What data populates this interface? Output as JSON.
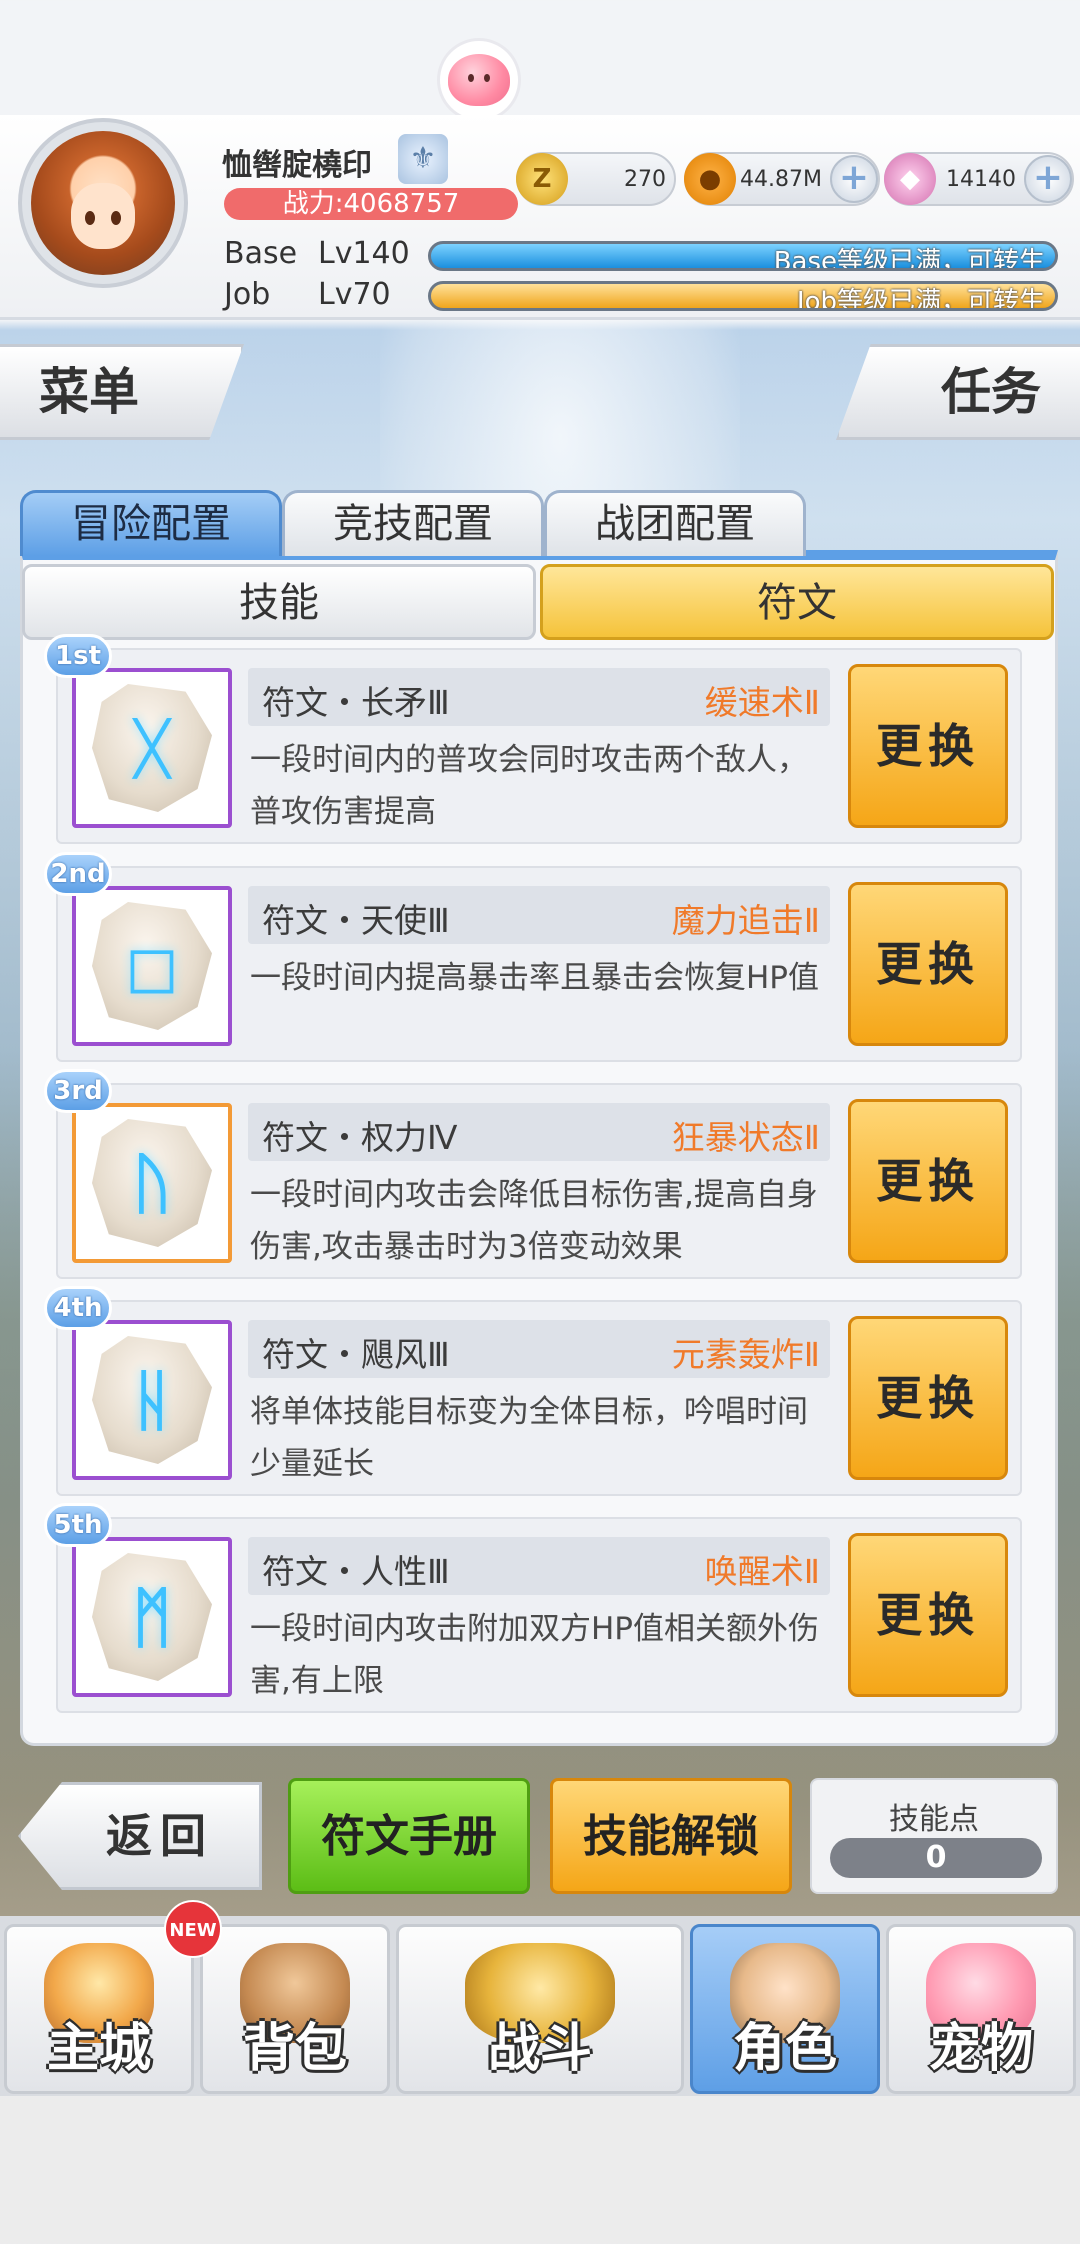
{
  "header": {
    "player_name": "恤辔腚橈印",
    "combat_power": "战力:4068757",
    "currencies": [
      {
        "name": "zeny",
        "icon": "zeny-coin-icon",
        "value": "270"
      },
      {
        "name": "gold",
        "icon": "gold-coin-icon",
        "value": "44.87M"
      },
      {
        "name": "gem",
        "icon": "diamond-icon",
        "value": "14140"
      }
    ],
    "base": {
      "label": "Base",
      "level": "Lv140",
      "status": "Base等级已满，可转生"
    },
    "job": {
      "label": "Job",
      "level": "Lv70",
      "status": "Job等级已满，可转生"
    }
  },
  "side_tabs": {
    "menu": "菜单",
    "quest": "任务"
  },
  "config_tabs": [
    {
      "label": "冒险配置",
      "active": true
    },
    {
      "label": "竞技配置",
      "active": false
    },
    {
      "label": "战团配置",
      "active": false
    }
  ],
  "sub_tabs": [
    {
      "label": "技能",
      "active": false
    },
    {
      "label": "符文",
      "active": true
    }
  ],
  "runes": [
    {
      "rank": "1st",
      "name": "符文・长矛Ⅲ",
      "skill": "缓速术Ⅱ",
      "desc": "一段时间内的普攻会同时攻击两个敌人，普攻伤害提高",
      "glyph": "ᚷ",
      "frame": "purple"
    },
    {
      "rank": "2nd",
      "name": "符文・天使Ⅲ",
      "skill": "魔力追击Ⅱ",
      "desc": "一段时间内提高暴击率且暴击会恢复HP值",
      "glyph": "◻",
      "frame": "purple"
    },
    {
      "rank": "3rd",
      "name": "符文・权力Ⅳ",
      "skill": "狂暴状态Ⅱ",
      "desc": "一段时间内攻击会降低目标伤害,提高自身伤害,攻击暴击时为3倍变动效果",
      "glyph": "ᚢ",
      "frame": "orange"
    },
    {
      "rank": "4th",
      "name": "符文・飓风Ⅲ",
      "skill": "元素轰炸Ⅱ",
      "desc": "将单体技能目标变为全体目标，吟唱时间少量延长",
      "glyph": "ᚺ",
      "frame": "purple"
    },
    {
      "rank": "5th",
      "name": "符文・人性Ⅲ",
      "skill": "唤醒术Ⅱ",
      "desc": "一段时间内攻击附加双方HP值相关额外伤害,有上限",
      "glyph": "ᛗ",
      "frame": "purple"
    }
  ],
  "swap_label": "更换",
  "actions": {
    "back": "返回",
    "rune_handbook": "符文手册",
    "skill_unlock": "技能解锁",
    "skill_points_label": "技能点",
    "skill_points_value": "0"
  },
  "nav": [
    {
      "label": "主城",
      "icon": "castle-icon",
      "active": false,
      "badge": "NEW"
    },
    {
      "label": "背包",
      "icon": "backpack-icon",
      "active": false
    },
    {
      "label": "战斗",
      "icon": "crossed-swords-icon",
      "active": false
    },
    {
      "label": "角色",
      "icon": "character-icon",
      "active": true
    },
    {
      "label": "宠物",
      "icon": "poring-pet-icon",
      "active": false
    }
  ],
  "colors": {
    "accent_blue": "#5d9fe6",
    "button_yellow": "#f5a617",
    "button_green": "#5cbd16",
    "skill_name_orange": "#f07a2a",
    "power_red": "#f06b6b"
  }
}
